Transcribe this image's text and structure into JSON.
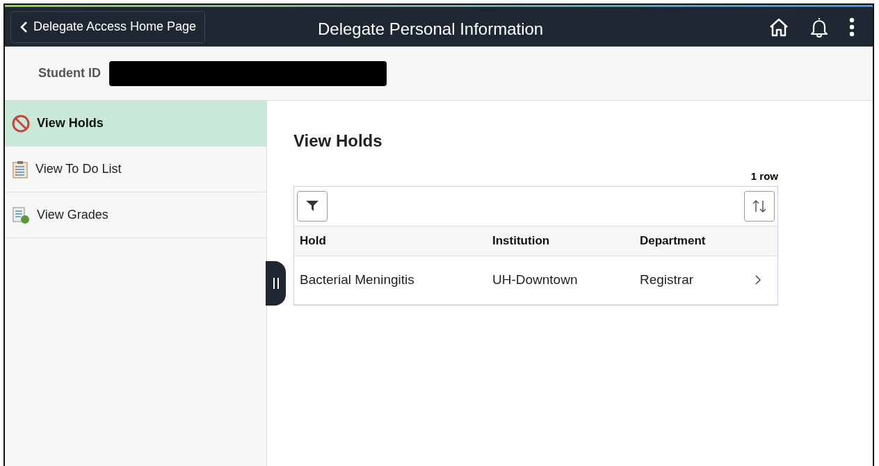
{
  "header": {
    "back_button": "Delegate Access Home Page",
    "title": "Delegate Personal Information"
  },
  "student_id": {
    "label": "Student ID",
    "redacted": true
  },
  "sidebar": {
    "items": [
      {
        "label": "View Holds",
        "kind": "holds",
        "selected": true
      },
      {
        "label": "View To Do List",
        "kind": "todo",
        "selected": false
      },
      {
        "label": "View Grades",
        "kind": "grades",
        "selected": false
      }
    ]
  },
  "content": {
    "title": "View Holds",
    "row_count": "1 row",
    "table": {
      "columns": [
        "Hold",
        "Institution",
        "Department"
      ],
      "rows": [
        [
          "Bacterial Meningitis",
          "UH-Downtown",
          "Registrar"
        ]
      ]
    }
  }
}
